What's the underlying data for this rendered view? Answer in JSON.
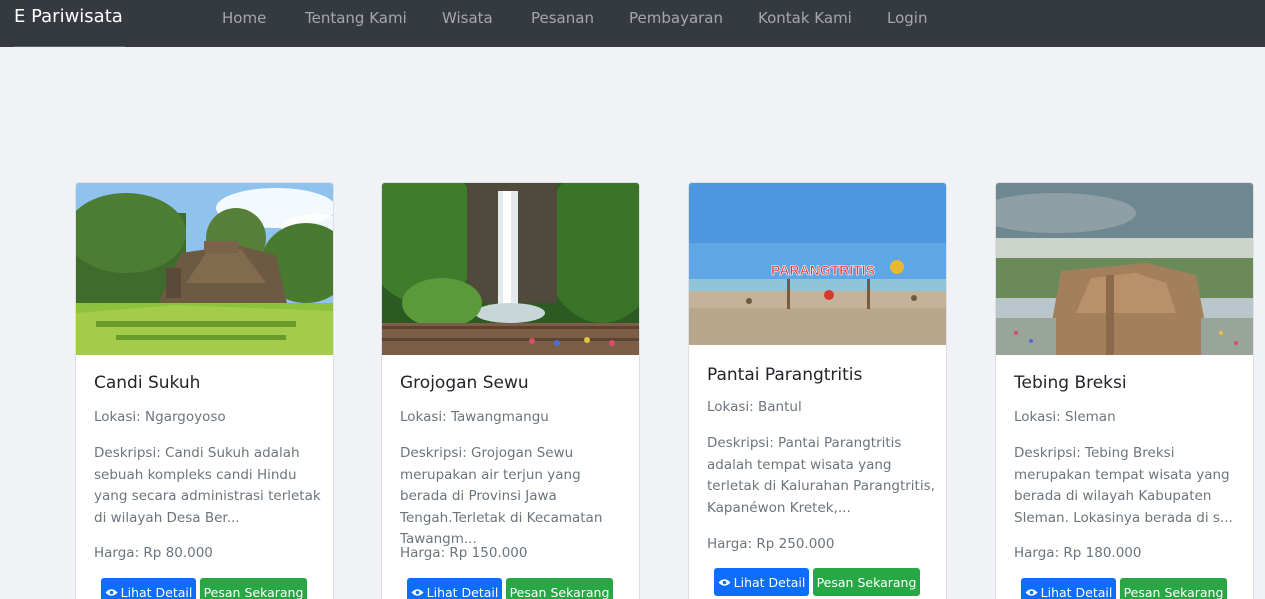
{
  "nav": {
    "brand": "E Pariwisata",
    "links": [
      "Home",
      "Tentang Kami",
      "Wisata",
      "Pesanan",
      "Pembayaran",
      "Kontak Kami",
      "Login"
    ]
  },
  "cards": [
    {
      "title": "Candi Sukuh",
      "location": "Lokasi: Ngargoyoso",
      "description": "Deskripsi: Candi Sukuh adalah sebuah kompleks candi Hindu yang secara administrasi terletak di wilayah Desa Ber...",
      "price": "Harga: Rp 80.000",
      "detail_label": "Lihat Detail",
      "order_label": "Pesan Sekarang"
    },
    {
      "title": "Grojogan Sewu",
      "location": "Lokasi: Tawangmangu",
      "description": "Deskripsi: Grojogan Sewu merupakan air terjun yang berada di Provinsi Jawa Tengah.Terletak di Kecamatan Tawangm...",
      "price": "Harga: Rp 150.000",
      "detail_label": "Lihat Detail",
      "order_label": "Pesan Sekarang"
    },
    {
      "title": "Pantai Parangtritis",
      "location": "Lokasi: Bantul",
      "description": "Deskripsi: Pantai Parangtritis adalah tempat wisata yang terletak di Kalurahan Parangtritis, Kapanéwon Kretek,...",
      "price": "Harga: Rp 250.000",
      "detail_label": "Lihat Detail",
      "order_label": "Pesan Sekarang",
      "sign_text": "PARANGTRITIS"
    },
    {
      "title": "Tebing Breksi",
      "location": "Lokasi: Sleman",
      "description": "Deskripsi: Tebing Breksi merupakan tempat wisata yang berada di wilayah Kabupaten Sleman. Lokasinya berada di s...",
      "price": "Harga: Rp 180.000",
      "detail_label": "Lihat Detail",
      "order_label": "Pesan Sekarang"
    }
  ],
  "icons": {
    "detail_button_icon": "eye-icon"
  },
  "colors": {
    "navbar": "#343a40",
    "page_background": "#f1f2f6",
    "primary_button": "#0d6efd",
    "success_button": "#28a745"
  }
}
